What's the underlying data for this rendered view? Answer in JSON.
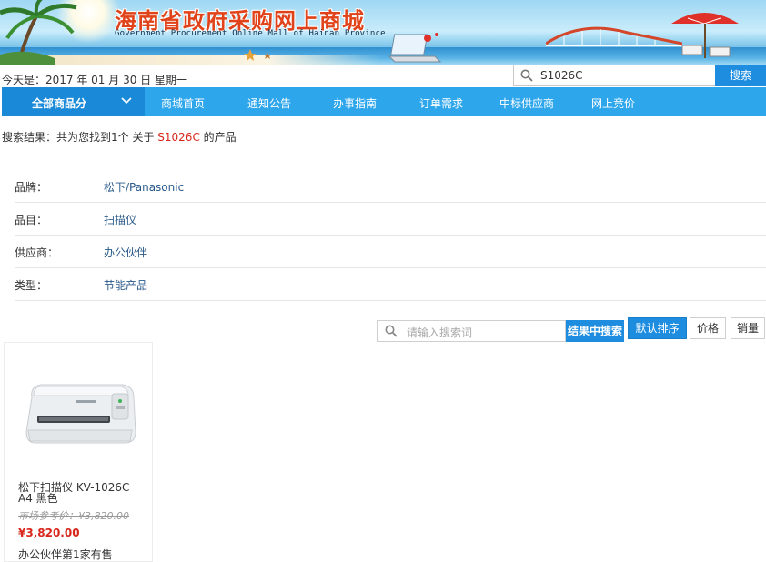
{
  "banner": {
    "title_cn": "海南省政府采购网上商城",
    "title_en": "Government Procurement Online Mall of Hainan Province"
  },
  "date_line": "今天是：2017 年 01 月 30 日 星期一",
  "top_search": {
    "value": "S1026C",
    "button_label": "搜索"
  },
  "nav": {
    "all_label": "全部商品分",
    "items": [
      "商城首页",
      "通知公告",
      "办事指南",
      "订单需求",
      "中标供应商",
      "网上竞价"
    ]
  },
  "result": {
    "prefix": "搜索结果：共为您找到1个 关于",
    "keyword": "S1026C",
    "suffix": "的产品"
  },
  "filters": [
    {
      "label": "品牌：",
      "value": "松下/Panasonic"
    },
    {
      "label": "品目：",
      "value": "扫描仪"
    },
    {
      "label": "供应商：",
      "value": "办公伙伴"
    },
    {
      "label": "类型：",
      "value": "节能产品"
    }
  ],
  "sub_search": {
    "placeholder": "请输入搜索词",
    "button_label": "结果中搜索"
  },
  "sort": {
    "default_label": "默认排序",
    "price_label": "价格",
    "sales_label": "销量"
  },
  "product": {
    "name": "松下扫描仪 KV-1026C A4 黑色",
    "market_price": "市场参考价：¥3,820.00",
    "price": "¥3,820.00",
    "supplier": "办公伙伴第1家有售"
  },
  "colors": {
    "nav_bg": "#2ea6ec",
    "nav_active": "#1a8ad8",
    "button_blue": "#1e8de0",
    "keyword_red": "#d8261c",
    "filter_link": "#2a5a8a"
  }
}
